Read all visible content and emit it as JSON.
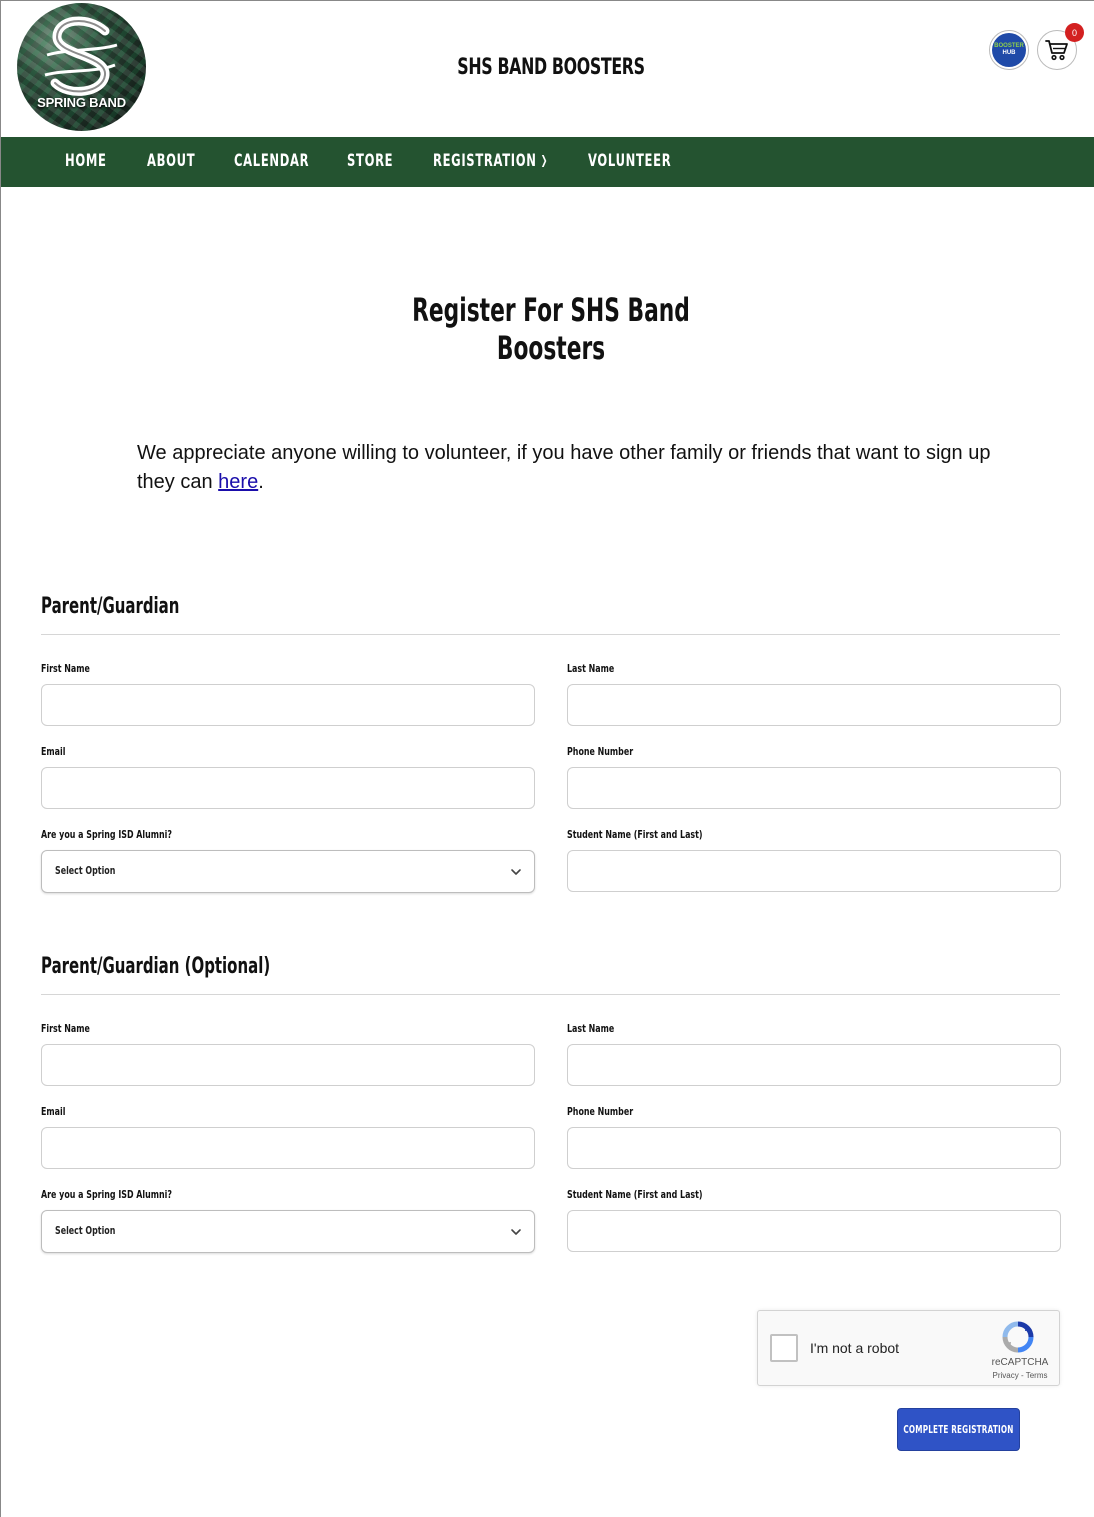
{
  "header": {
    "logo_text": "SPRING BAND",
    "site_title": "SHS BAND BOOSTERS",
    "hub_badge": {
      "line1": "BOOSTER",
      "line2": "HUB"
    },
    "cart_count": "0"
  },
  "nav": {
    "items": [
      {
        "label": "HOME"
      },
      {
        "label": "ABOUT"
      },
      {
        "label": "CALENDAR"
      },
      {
        "label": "STORE"
      },
      {
        "label": "REGISTRATION"
      },
      {
        "label": "VOLUNTEER"
      }
    ]
  },
  "main": {
    "heading": "Register For SHS Band Boosters",
    "intro_text": "We appreciate anyone willing to volunteer, if you have other family or friends that want to sign up they can ",
    "intro_link": "here",
    "intro_end": "."
  },
  "sections": [
    {
      "title": "Parent/Guardian",
      "labels": {
        "first_name": "First Name",
        "last_name": "Last Name",
        "email": "Email",
        "phone": "Phone Number",
        "alumni": "Are you a Spring ISD Alumni?",
        "student": "Student Name (First and Last)"
      },
      "alumni_selected": "Select Option",
      "values": {
        "first_name": "",
        "last_name": "",
        "email": "",
        "phone": "",
        "student": ""
      }
    },
    {
      "title": "Parent/Guardian (Optional)",
      "labels": {
        "first_name": "First Name",
        "last_name": "Last Name",
        "email": "Email",
        "phone": "Phone Number",
        "alumni": "Are you a Spring ISD Alumni?",
        "student": "Student Name (First and Last)"
      },
      "alumni_selected": "Select Option",
      "values": {
        "first_name": "",
        "last_name": "",
        "email": "",
        "phone": "",
        "student": ""
      }
    }
  ],
  "captcha": {
    "label": "I'm not a robot",
    "brand": "reCAPTCHA",
    "links": "Privacy - Terms"
  },
  "submit_label": "COMPLETE REGISTRATION",
  "colors": {
    "nav_bg": "#245330",
    "button_bg": "#2f53c6",
    "cart_badge": "#d32020",
    "link": "#1a0dab"
  }
}
